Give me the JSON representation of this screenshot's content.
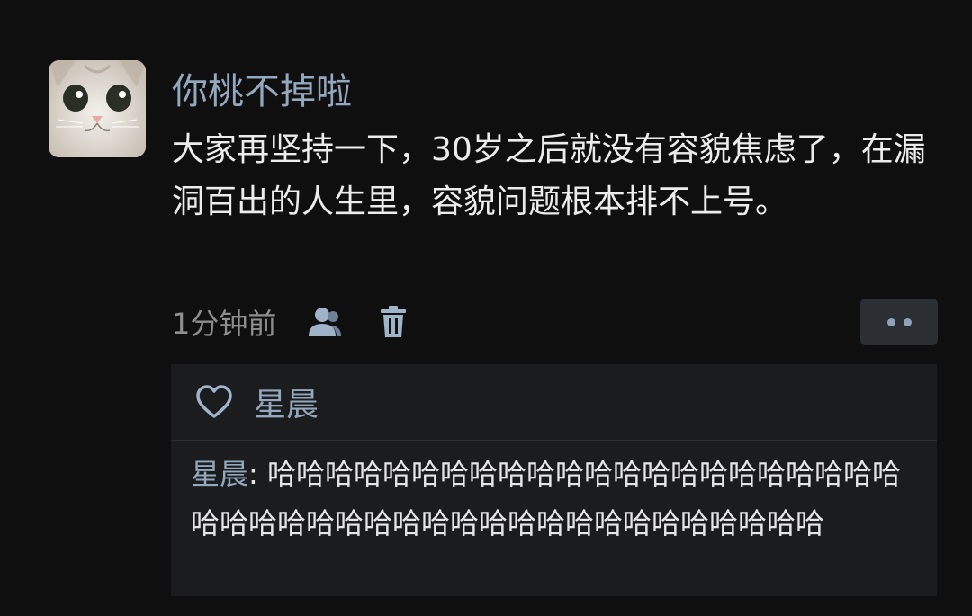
{
  "post": {
    "username": "你桃不掉啦",
    "text": "大家再坚持一下，30岁之后就没有容貌焦虑了，在漏洞百出的人生里，容貌问题根本排不上号。",
    "time": "1分钟前",
    "icons": [
      "avatar-cat",
      "users-icon",
      "trash-icon",
      "more-icon"
    ]
  },
  "reply_box": {
    "likes": {
      "icon": "heart-icon",
      "names": "星晨"
    },
    "comment": {
      "author": "星晨",
      "separator": ": ",
      "text": "哈哈哈哈哈哈哈哈哈哈哈哈哈哈哈哈哈哈哈哈哈哈哈哈哈哈哈哈哈哈哈哈哈哈哈哈哈哈哈哈哈哈哈哈"
    }
  },
  "colors": {
    "background": "#0f0f10",
    "name_link": "#93a7bd",
    "reply_box_bg": "#1b1c1e",
    "muted_text": "#8e8e8e"
  }
}
